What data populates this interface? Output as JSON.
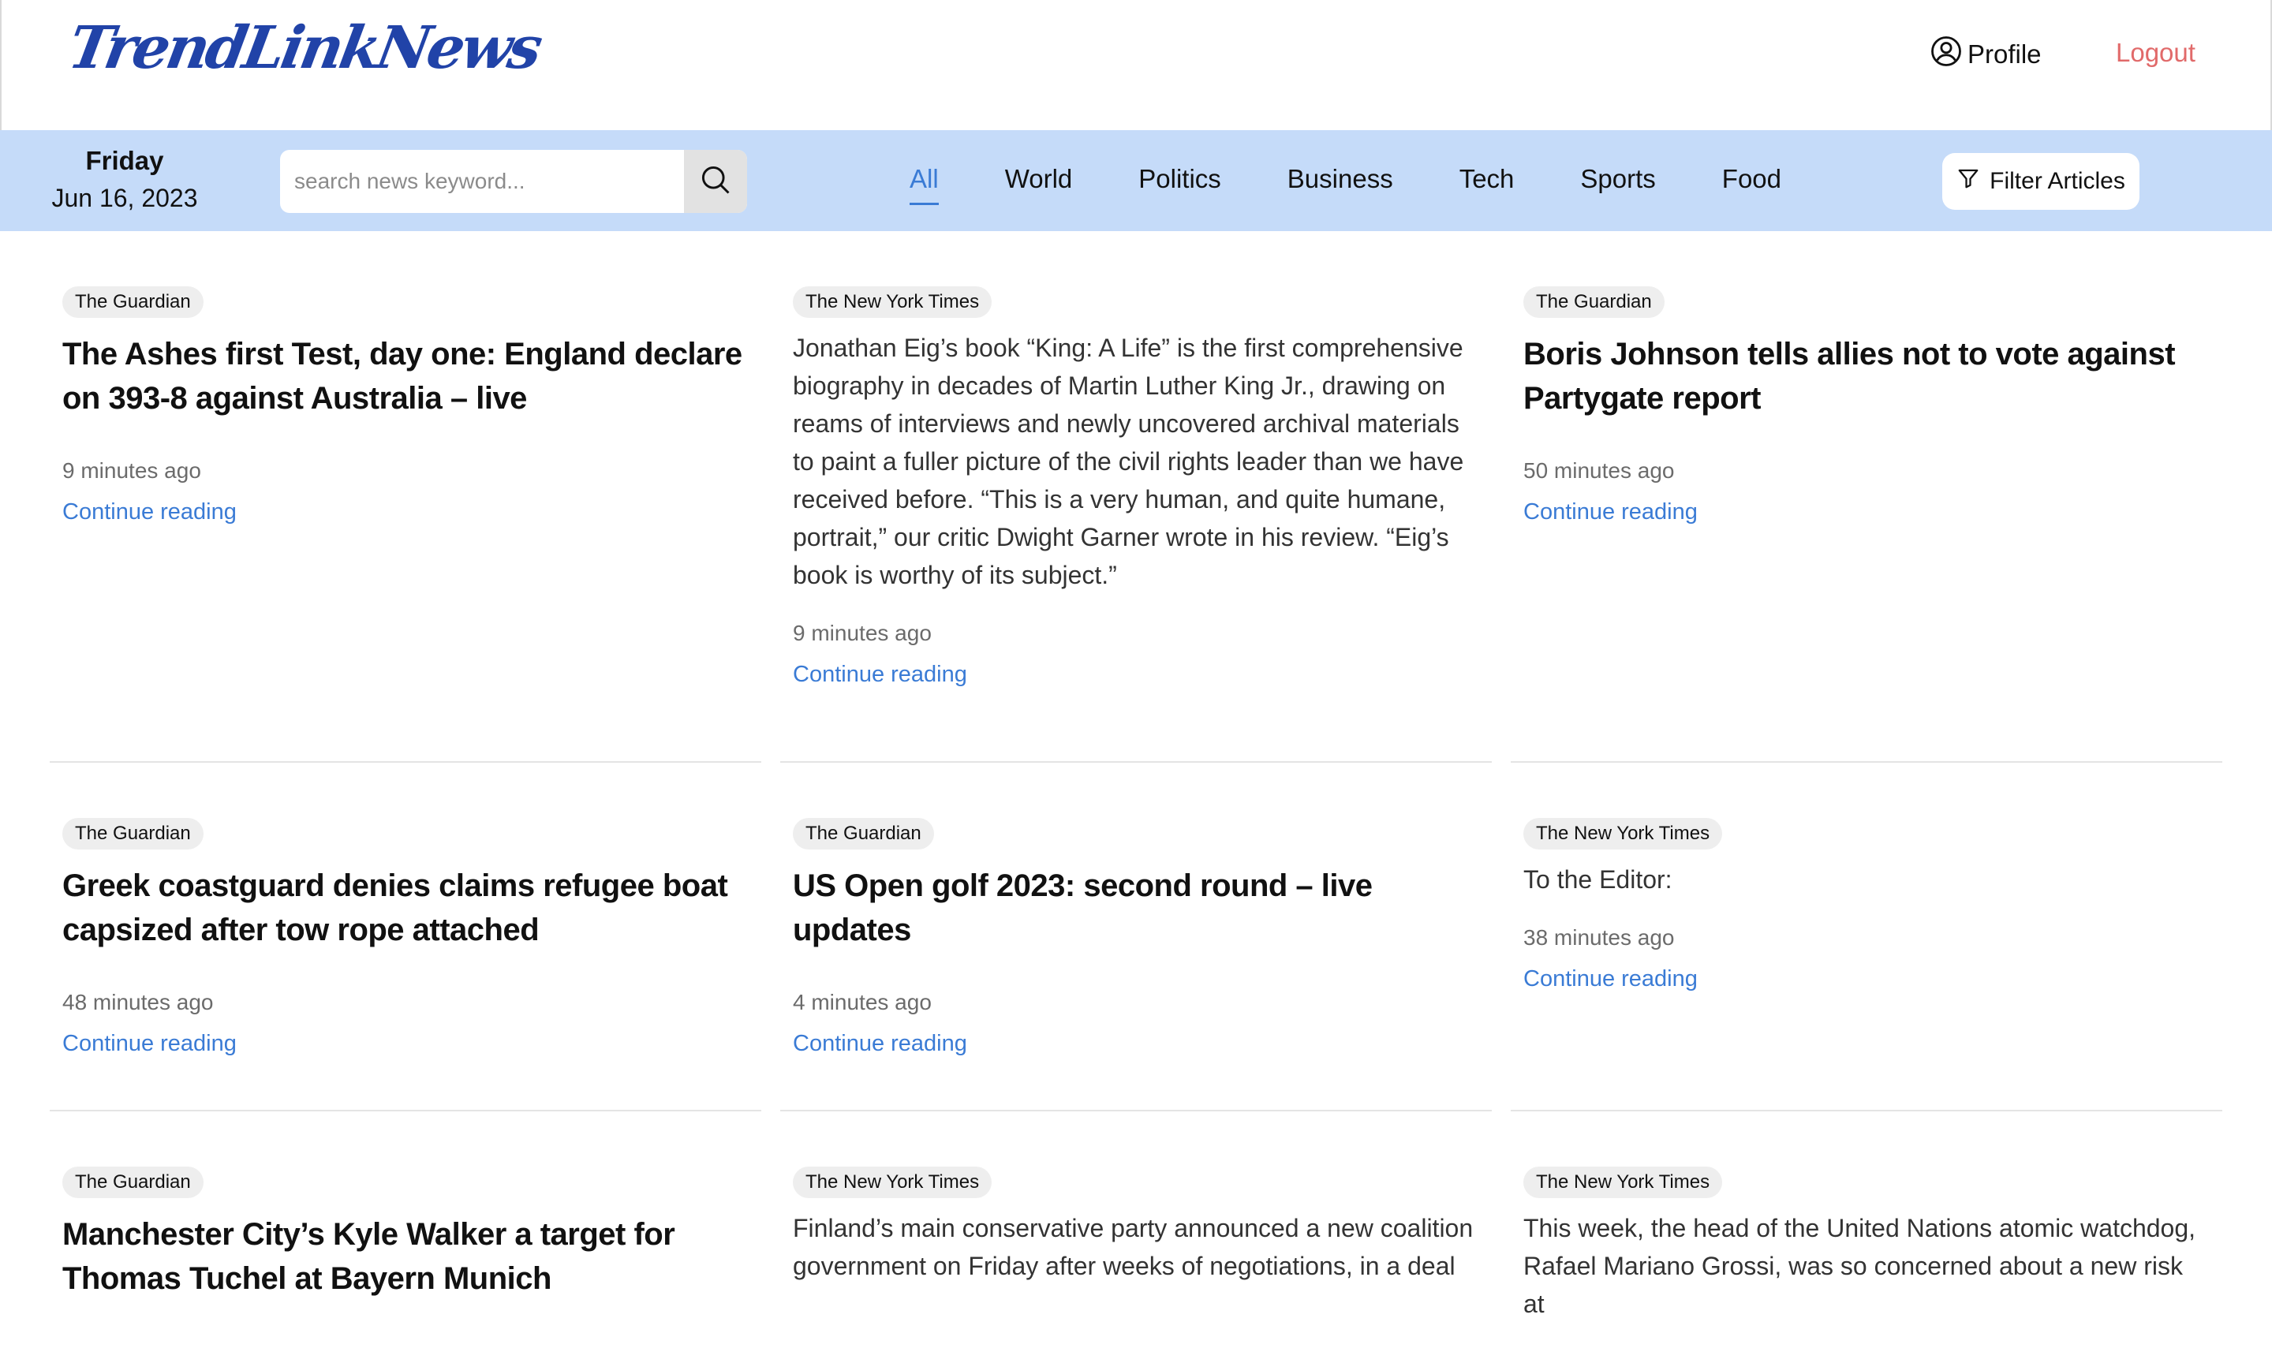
{
  "header": {
    "logo": "TrendLinkNews",
    "profile_label": "Profile",
    "logout_label": "Logout"
  },
  "nav": {
    "day": "Friday",
    "date": "Jun 16, 2023",
    "search_placeholder": "search news keyword...",
    "tabs": [
      "All",
      "World",
      "Politics",
      "Business",
      "Tech",
      "Sports",
      "Food"
    ],
    "active_tab": "All",
    "filter_label": "Filter Articles"
  },
  "colors": {
    "brand": "#2143a8",
    "nav_bg": "#c5dbf9",
    "link": "#3a7bd5",
    "logout": "#e16a6a"
  },
  "articles": [
    {
      "source": "The Guardian",
      "headline": "The Ashes first Test, day one: England declare on 393-8 against Australia – live",
      "time": "9 minutes ago",
      "link": "Continue reading"
    },
    {
      "source": "The New York Times",
      "summary": "Jonathan Eig’s book “King: A Life” is the first comprehensive biography in decades of Martin Luther King Jr., drawing on reams of interviews and newly uncovered archival materials to paint a fuller picture of the civil rights leader than we have received before. “This is a very human, and quite humane, portrait,” our critic Dwight Garner wrote in his review. “Eig’s book is worthy of its subject.”",
      "time": "9 minutes ago",
      "link": "Continue reading"
    },
    {
      "source": "The Guardian",
      "headline": "Boris Johnson tells allies not to vote against Partygate report",
      "time": "50 minutes ago",
      "link": "Continue reading"
    },
    {
      "source": "The Guardian",
      "headline": "Greek coastguard denies claims refugee boat capsized after tow rope attached",
      "time": "48 minutes ago",
      "link": "Continue reading"
    },
    {
      "source": "The Guardian",
      "headline": "US Open golf 2023: second round – live updates",
      "time": "4 minutes ago",
      "link": "Continue reading"
    },
    {
      "source": "The New York Times",
      "summary": "To the Editor:",
      "time": "38 minutes ago",
      "link": "Continue reading"
    },
    {
      "source": "The Guardian",
      "headline": "Manchester City’s Kyle Walker a target for Thomas Tuchel at Bayern Munich"
    },
    {
      "source": "The New York Times",
      "summary": "Finland’s main conservative party announced a new coalition government on Friday after weeks of negotiations, in a deal"
    },
    {
      "source": "The New York Times",
      "summary": "This week, the head of the United Nations atomic watchdog, Rafael Mariano Grossi, was so concerned about a new risk at"
    }
  ]
}
